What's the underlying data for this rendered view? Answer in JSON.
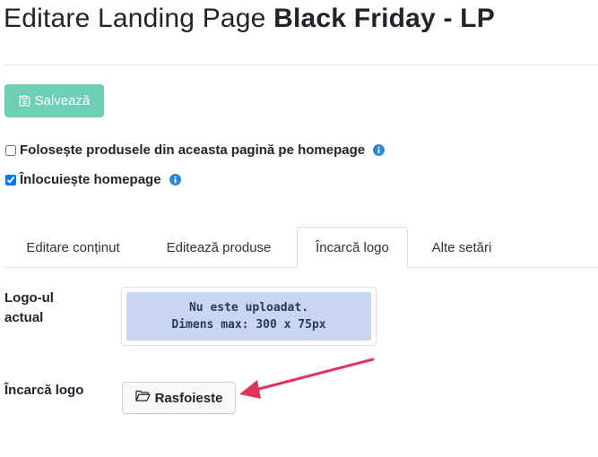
{
  "page": {
    "title_prefix": "Editare Landing Page",
    "title_name": "Black Friday - LP"
  },
  "toolbar": {
    "save_label": "Salvează"
  },
  "options": {
    "use_products_label": "Folosește produsele din aceasta pagină pe homepage",
    "use_products_checked": false,
    "replace_homepage_label": "Înlocuiește homepage",
    "replace_homepage_checked": true
  },
  "tabs": [
    {
      "label": "Editare conținut",
      "active": false
    },
    {
      "label": "Editează produse",
      "active": false
    },
    {
      "label": "Încarcă logo",
      "active": true
    },
    {
      "label": "Alte setări",
      "active": false
    }
  ],
  "logo": {
    "current_label": "Logo-ul actual",
    "placeholder_line1": "Nu este uploadat.",
    "placeholder_line2": "Dimens max: 300 x 75px",
    "upload_label": "Încarcă logo",
    "browse_label": "Rasfoieste"
  },
  "colors": {
    "save_button": "#6fcfb3",
    "info_icon": "#2f86d4",
    "placeholder_bg": "#c8d6f2",
    "annotation_arrow": "#e0345a"
  },
  "icons": {
    "save": "floppy-disk-icon",
    "info": "info-circle-icon",
    "browse": "folder-open-icon"
  }
}
